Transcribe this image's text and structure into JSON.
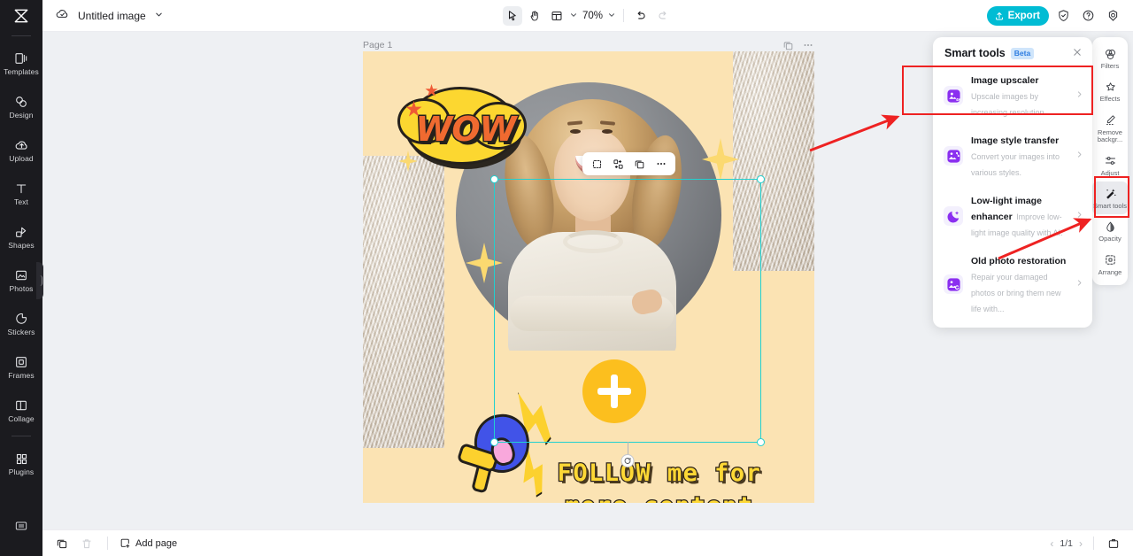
{
  "app": {
    "document_title": "Untitled image",
    "zoom_level": "70%",
    "page_label": "Page 1",
    "export_label": "Export"
  },
  "left_rail": {
    "logo": "app-logo",
    "items": [
      {
        "label": "Templates",
        "icon": "templates-icon"
      },
      {
        "label": "Design",
        "icon": "design-icon"
      },
      {
        "label": "Upload",
        "icon": "upload-icon"
      },
      {
        "label": "Text",
        "icon": "text-icon"
      },
      {
        "label": "Shapes",
        "icon": "shapes-icon"
      },
      {
        "label": "Photos",
        "icon": "photos-icon"
      },
      {
        "label": "Stickers",
        "icon": "stickers-icon"
      },
      {
        "label": "Frames",
        "icon": "frames-icon"
      },
      {
        "label": "Collage",
        "icon": "collage-icon"
      },
      {
        "label": "Plugins",
        "icon": "plugins-icon"
      }
    ]
  },
  "toolbar": {
    "select_tool": "cursor-icon",
    "hand_tool": "hand-icon",
    "layout_tool": "layout-icon",
    "undo": "undo-icon",
    "redo": "redo-icon",
    "shield": "shield-icon",
    "help": "help-icon",
    "settings": "settings-icon"
  },
  "element_toolbar": {
    "buttons": [
      "crop-icon",
      "replace-icon",
      "duplicate-icon",
      "more-icon"
    ]
  },
  "artboard": {
    "wow_text": "WOW",
    "follow_text": "FOLLOW me for more content",
    "add_button": "plus-icon",
    "background_color": "#fbe3b3",
    "accent_yellow": "#fcd730",
    "accent_orange": "#f06a30",
    "selection_color": "#21d0d0"
  },
  "smart_tools_panel": {
    "title": "Smart tools",
    "badge": "Beta",
    "close": "close-icon",
    "items": [
      {
        "name": "Image upscaler",
        "desc": "Upscale images by increasing resolution.",
        "icon": "upscaler-icon"
      },
      {
        "name": "Image style transfer",
        "desc": "Convert your images into various styles.",
        "icon": "style-transfer-icon"
      },
      {
        "name": "Low-light image enhancer",
        "desc": "Improve low-light image quality with AI.",
        "icon": "low-light-icon"
      },
      {
        "name": "Old photo restoration",
        "desc": "Repair your damaged photos or bring them new life with...",
        "icon": "restoration-icon"
      }
    ]
  },
  "right_rail": {
    "items": [
      {
        "label": "Filters",
        "icon": "filters-icon",
        "active": false
      },
      {
        "label": "Effects",
        "icon": "effects-icon",
        "active": false
      },
      {
        "label": "Remove backgr...",
        "icon": "remove-bg-icon",
        "active": false
      },
      {
        "label": "Adjust",
        "icon": "adjust-icon",
        "active": false
      },
      {
        "label": "Smart tools",
        "icon": "smart-tools-icon",
        "active": true
      },
      {
        "label": "Opacity",
        "icon": "opacity-icon",
        "active": false
      },
      {
        "label": "Arrange",
        "icon": "arrange-icon",
        "active": false
      }
    ]
  },
  "bottom_bar": {
    "duplicate_page": "duplicate-page-icon",
    "delete_page": "delete-page-icon",
    "add_page_label": "Add page",
    "page_indicator": "1/1",
    "prev": "‹",
    "next": "›",
    "notes": "notes-icon"
  },
  "annotations": {
    "highlight_color": "#ee2222",
    "boxes": [
      "image-upscaler-row",
      "smart-tools-rail-button"
    ],
    "arrows": 2
  }
}
